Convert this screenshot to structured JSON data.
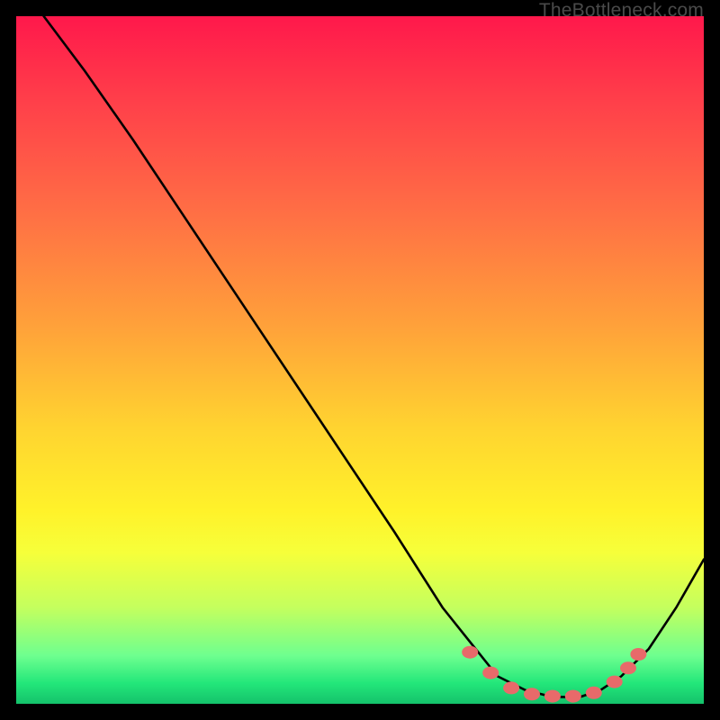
{
  "watermark": "TheBottleneck.com",
  "chart_data": {
    "type": "line",
    "title": "",
    "xlabel": "",
    "ylabel": "",
    "xlim": [
      0,
      100
    ],
    "ylim": [
      0,
      100
    ],
    "background": "rainbow-gradient-vertical",
    "series": [
      {
        "name": "bottleneck-curve",
        "x": [
          4,
          10,
          17,
          25,
          35,
          45,
          55,
          62,
          66,
          70,
          74,
          78,
          82,
          85,
          88,
          92,
          96,
          100
        ],
        "y": [
          100,
          92,
          82,
          70,
          55,
          40,
          25,
          14,
          9,
          4,
          2,
          1,
          1,
          2,
          4,
          8,
          14,
          21
        ]
      }
    ],
    "markers": {
      "name": "fit-region-dots",
      "color": "#e86a6a",
      "points": [
        {
          "x": 66,
          "y": 7.5
        },
        {
          "x": 69,
          "y": 4.5
        },
        {
          "x": 72,
          "y": 2.3
        },
        {
          "x": 75,
          "y": 1.4
        },
        {
          "x": 78,
          "y": 1.1
        },
        {
          "x": 81,
          "y": 1.1
        },
        {
          "x": 84,
          "y": 1.6
        },
        {
          "x": 87,
          "y": 3.2
        },
        {
          "x": 89,
          "y": 5.2
        },
        {
          "x": 90.5,
          "y": 7.2
        }
      ]
    }
  }
}
